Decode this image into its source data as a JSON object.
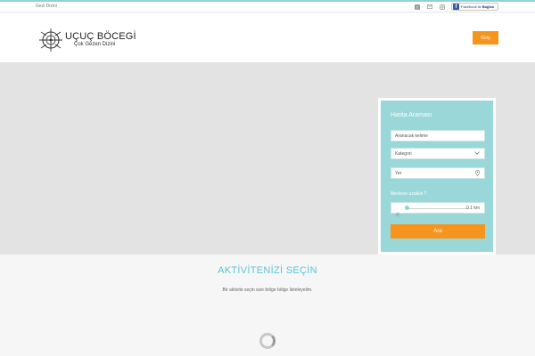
{
  "topbar": {
    "left_link": "Gezi Dizini",
    "social": [
      {
        "icon": "facebook-icon"
      },
      {
        "icon": "mail-icon"
      },
      {
        "icon": "instagram-icon"
      }
    ],
    "facebook_button": {
      "prefix": "Facebook ile ",
      "bold": "Bağlan"
    }
  },
  "header": {
    "logo_name": "UÇUÇ BÖCEGİ",
    "logo_tagline": "Çok Gezen Dizini",
    "login_label": "Giriş"
  },
  "search": {
    "title": "Harita Araması",
    "keyword_placeholder": "Aranacak kelime",
    "category_value": "Kategori",
    "location_value": "Yer",
    "radius_label": "Merkeze uzaklık ?",
    "radius_value": "0.1 km",
    "radius_fraction": 0.02,
    "search_label": "Ara"
  },
  "section": {
    "title": "AKTİVİTENİZİ SEÇİN",
    "subtitle": "Bir aktivite seçin size bölge bölge listeleyelim."
  },
  "colors": {
    "accent_teal": "#9ad7d8",
    "accent_orange": "#f7941d",
    "title_teal": "#58c6d2",
    "facebook_blue": "#3b5998"
  }
}
